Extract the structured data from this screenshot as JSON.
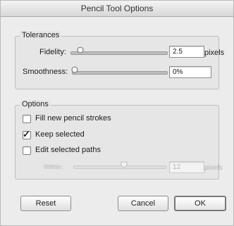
{
  "window": {
    "title": "Pencil Tool Options"
  },
  "tolerances": {
    "legend": "Tolerances",
    "fidelity": {
      "label": "Fidelity:",
      "value": "2.5",
      "unit": "pixels",
      "slider_position": 0.08
    },
    "smoothness": {
      "label": "Smoothness:",
      "value": "0%",
      "slider_position": 0.0
    }
  },
  "options": {
    "legend": "Options",
    "fill_new": {
      "label": "Fill new pencil strokes",
      "checked": false
    },
    "keep_selected": {
      "label": "Keep selected",
      "checked": true
    },
    "edit_selected": {
      "label": "Edit selected paths",
      "checked": false
    },
    "within": {
      "label": "Within:",
      "value": "12",
      "unit": "pixels",
      "slider_position": 0.55,
      "disabled": true
    }
  },
  "buttons": {
    "reset": "Reset",
    "cancel": "Cancel",
    "ok": "OK"
  }
}
